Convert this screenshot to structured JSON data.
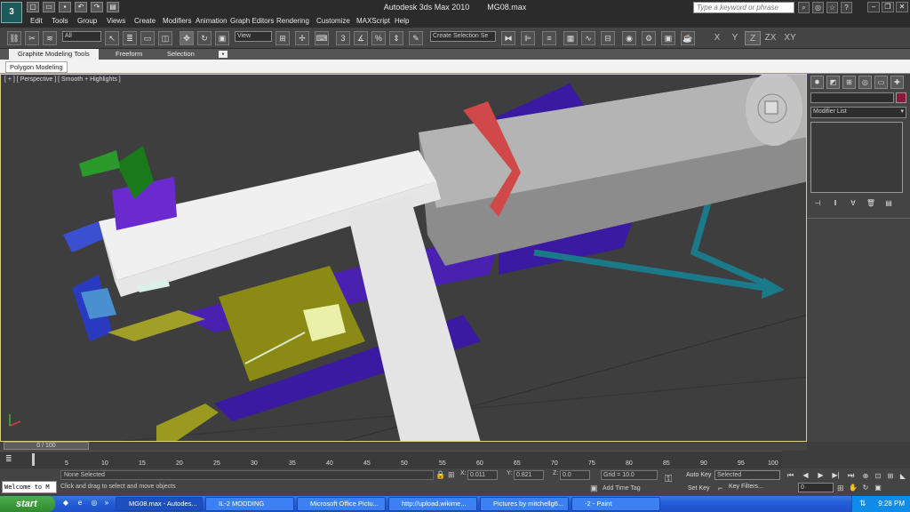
{
  "app": {
    "logo": "3",
    "title_app": "Autodesk 3ds Max  2010",
    "title_file": "MG08.max",
    "search_placeholder": "Type a keyword or phrase"
  },
  "menu": [
    "Edit",
    "Tools",
    "Group",
    "Views",
    "Create",
    "Modifiers",
    "Animation",
    "Graph Editors",
    "Rendering",
    "Customize",
    "MAXScript",
    "Help"
  ],
  "toolbar": {
    "filter_select": "All",
    "ref_coord_select": "View",
    "named_selection_select": "Create Selection Se",
    "axis_constraints": [
      "X",
      "Y",
      "Z",
      "ZX",
      "XY"
    ]
  },
  "ribbon": {
    "tabs": [
      "Graphite Modeling Tools",
      "Freeform",
      "Selection"
    ],
    "sub_label": "Polygon Modeling"
  },
  "viewport": {
    "label": "[ + ] [ Perspective ] [ Smooth + Highlights ]"
  },
  "command_panel": {
    "modifier_list": "Modifier List"
  },
  "time_slider": {
    "label": "0 / 100"
  },
  "trackbar": {
    "ticks": [
      "5",
      "10",
      "15",
      "20",
      "25",
      "30",
      "35",
      "40",
      "45",
      "50",
      "55",
      "60",
      "65",
      "70",
      "75",
      "80",
      "85",
      "90",
      "95",
      "100"
    ]
  },
  "status": {
    "maxscript_listener": "Welcome to M",
    "selection_status": "None Selected",
    "prompt": "Click and drag to select and move objects",
    "x_label": "X:",
    "x_value": "0.011",
    "y_label": "Y:",
    "y_value": "0.821",
    "z_label": "Z:",
    "z_value": "0.0",
    "grid": "Grid = 10.0",
    "add_time_tag": "Add Time Tag",
    "auto_key": "Auto Key",
    "auto_key_select": "Selected",
    "set_key": "Set Key",
    "key_filters": "Key Filters...",
    "frame": "0"
  },
  "taskbar": {
    "start": "start",
    "items": [
      "MG08.max - Autodes...",
      "IL-2 MODDING",
      "Microsoft Office Pictu...",
      "http://upload.wikime...",
      "Pictures by mitchellg6...",
      "-2 - Paint"
    ],
    "clock": "9:28 PM"
  },
  "colors": {
    "viewport_border": "#d9d080",
    "taskbar_blue": "#245edb",
    "start_green": "#2f8a2f"
  }
}
